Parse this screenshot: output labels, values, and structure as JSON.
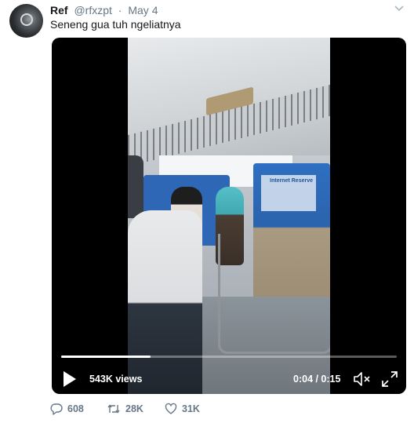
{
  "tweet": {
    "name": "Ref",
    "handle": "@rfxzpt",
    "dot": "·",
    "date": "May 4",
    "text": "Seneng gua tuh ngeliatnya"
  },
  "video": {
    "views": "543K views",
    "time": "0:04 / 0:15",
    "progress": 0.2667,
    "seat_sign": "Internet Reserve"
  },
  "actions": {
    "replies": "608",
    "retweets": "28K",
    "likes": "31K"
  },
  "icons": {
    "reply": "reply-icon",
    "retweet": "retweet-icon",
    "like": "heart-icon",
    "play": "play-icon",
    "volume": "volume-icon",
    "fullscreen": "fullscreen-icon",
    "caret": "chevron-down-icon"
  },
  "colors": {
    "text": "#14171a",
    "secondary": "#657786",
    "video_bg": "#000000"
  }
}
